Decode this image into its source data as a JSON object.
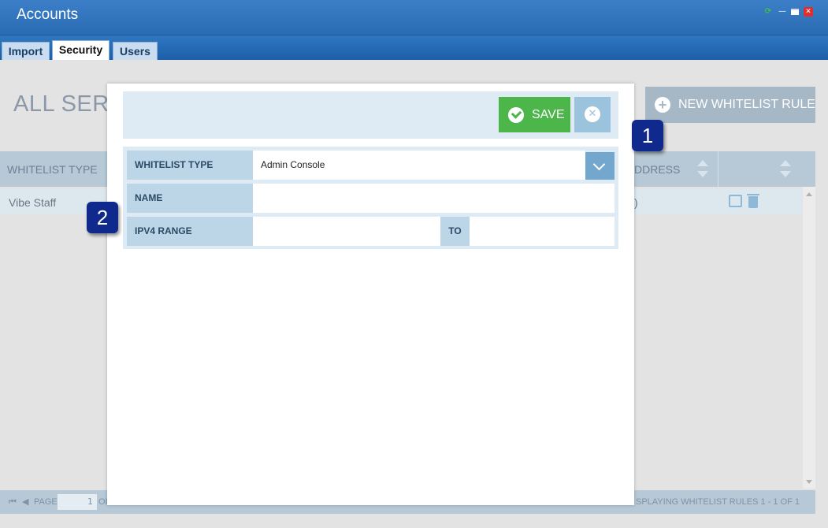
{
  "window": {
    "title": "Accounts",
    "controls": [
      "refresh-icon",
      "minimize-icon",
      "maximize-icon",
      "close-icon"
    ]
  },
  "tabs": [
    {
      "label": "Import",
      "active": false
    },
    {
      "label": "Security",
      "active": true
    },
    {
      "label": "Users",
      "active": false
    }
  ],
  "page": {
    "heading": "ALL SERV",
    "new_rule_label": "NEW WHITELIST RULE"
  },
  "grid": {
    "columns": [
      "WHITELIST TYPE",
      "DDRESS"
    ],
    "rows": [
      {
        "type": "Vibe Staff",
        "address": ")"
      }
    ]
  },
  "pager": {
    "page_label": "PAGE",
    "page_value": "1",
    "of_label": "OI",
    "display_text": "SPLAYING WHITELIST RULES 1 - 1 OF 1"
  },
  "modal": {
    "save_label": "SAVE",
    "fields": {
      "whitelist_type_label": "WHITELIST TYPE",
      "whitelist_type_value": "Admin Console",
      "name_label": "NAME",
      "name_value": "",
      "ipv4_label": "IPV4 RANGE",
      "ipv4_from": "",
      "to_label": "TO",
      "ipv4_to": ""
    }
  },
  "callouts": [
    "1",
    "2"
  ],
  "colors": {
    "title_bar": "#2a6cb3",
    "save_button": "#4cb64a",
    "callout": "#0f2a8c",
    "form_label_bg": "#bcd6e8"
  }
}
